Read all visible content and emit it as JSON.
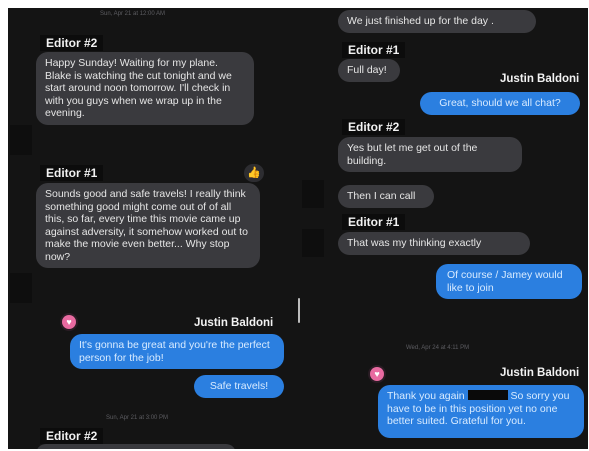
{
  "left": {
    "timestamp_top": "Sun, Apr 21 at 12:00 AM",
    "editor2_tag": "Editor #2",
    "msg_editor2": "Happy Sunday! Waiting for my plane. Blake is watching the cut tonight and we start around noon tomorrow. I'll check in with you guys when we wrap up in the evening.",
    "editor1_tag": "Editor #1",
    "reaction": "👍",
    "msg_editor1": "Sounds good and safe travels! I really think something good might come out of of all this, so far, every time this movie came up against adversity, it somehow worked out to make the movie even better... Why stop now?",
    "sender_justin": "Justin Baldoni",
    "heart": "♥",
    "msg_justin1": "It's gonna be great and you're the perfect person for the job!",
    "msg_justin2": "Safe travels!",
    "timestamp_bottom": "Sun, Apr 21 at 3:00 PM",
    "editor2_tag_bottom": "Editor #2"
  },
  "right": {
    "msg_top": "We just finished up for the day .",
    "editor1_tag": "Editor #1",
    "msg_fullday": "Full day!",
    "sender_justin": "Justin Baldoni",
    "msg_justin_chat": "Great, should we all chat?",
    "editor2_tag": "Editor #2",
    "msg_building": "Yes but let me get out of the building.",
    "msg_call": "Then I can call",
    "editor1_tag_2": "Editor #1",
    "msg_thinking": "That was my thinking exactly",
    "msg_ofcourse": "Of course / Jamey would like to join",
    "timestamp": "Wed, Apr 24 at 4:11 PM",
    "heart": "♥",
    "sender_justin_2": "Justin Baldoni",
    "msg_thankyou_a": "Thank you again",
    "msg_thankyou_b": "So sorry you have to be in this position yet no one better suited. Grateful for you."
  },
  "colors": {
    "incoming": "#3a3a3e",
    "outgoing": "#2b7fe0",
    "background": "#141414"
  }
}
